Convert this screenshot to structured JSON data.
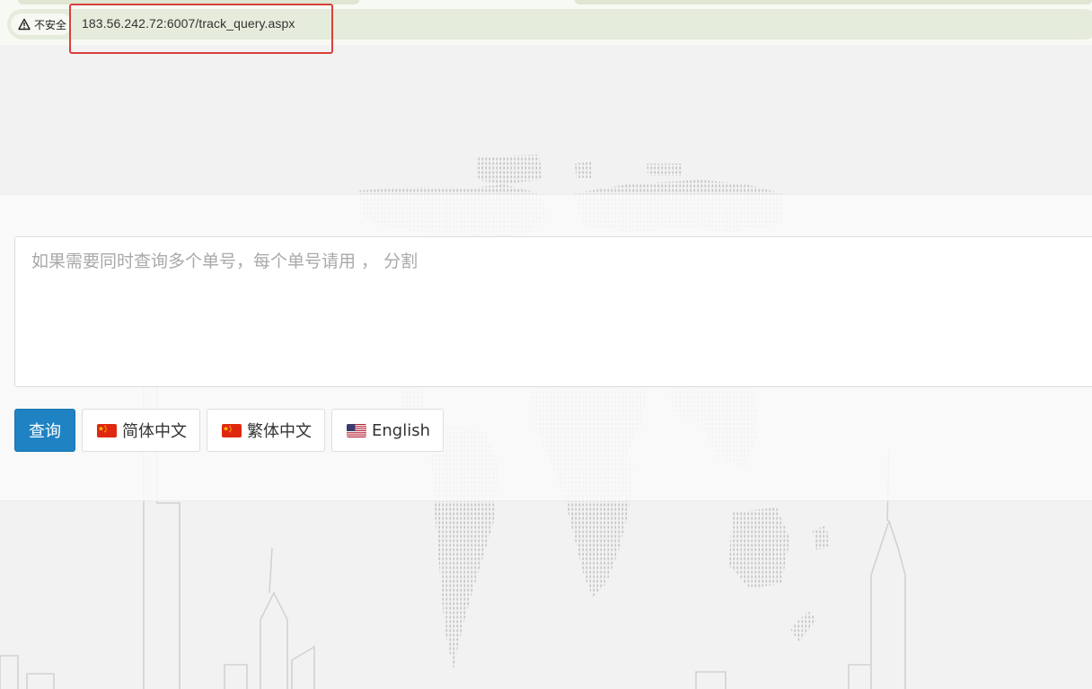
{
  "browser": {
    "security_label": "不安全",
    "url": "183.56.242.72:6007/track_query.aspx"
  },
  "query": {
    "placeholder": "如果需要同时查询多个单号，每个单号请用 ， 分割"
  },
  "buttons": {
    "search": "查询",
    "simplified_chinese": "简体中文",
    "traditional_chinese": "繁体中文",
    "english": "English"
  },
  "colors": {
    "primary": "#1f83c3",
    "highlight": "#d9403a"
  },
  "icons": {
    "security": "warning-triangle-icon",
    "simplified_chinese_flag": "china-flag-icon",
    "traditional_chinese_flag": "china-flag-icon",
    "english_flag": "usa-flag-icon"
  }
}
